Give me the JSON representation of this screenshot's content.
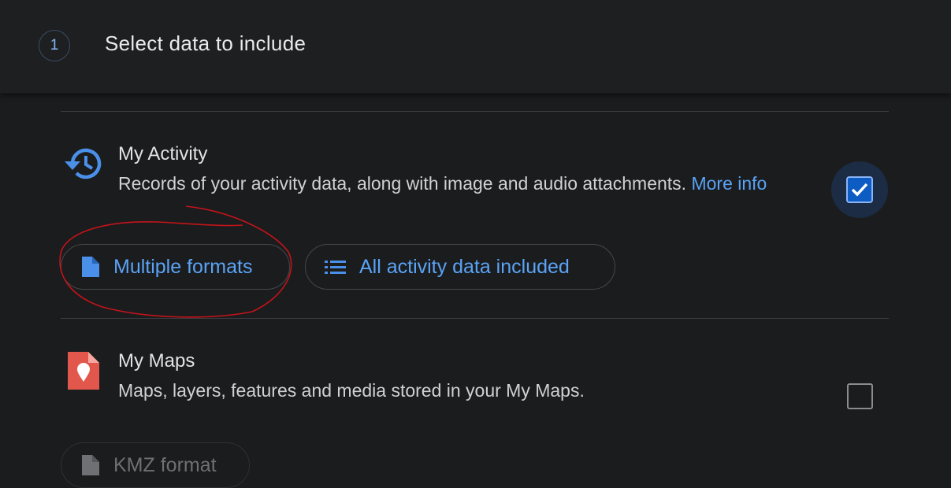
{
  "step": {
    "number": "1",
    "title": "Select data to include"
  },
  "products": [
    {
      "name": "My Activity",
      "description": "Records of your activity data, along with image and audio attachments.",
      "more_info_link": "More info",
      "checked": true,
      "icon": "history-clock-icon",
      "chips": [
        {
          "label": "Multiple formats",
          "icon": "file-icon"
        },
        {
          "label": "All activity data included",
          "icon": "list-icon"
        }
      ]
    },
    {
      "name": "My Maps",
      "description": "Maps, layers, features and media stored in your My Maps.",
      "checked": false,
      "icon": "my-maps-icon",
      "chips": [
        {
          "label": "KMZ format",
          "icon": "file-icon",
          "disabled": true
        }
      ]
    }
  ],
  "colors": {
    "background": "#1b1c1e",
    "accent_blue": "#5aa3f5",
    "checkbox_fill": "#0d5cc4",
    "my_maps_red": "#e2574c",
    "annotation_red": "#c4141a"
  }
}
